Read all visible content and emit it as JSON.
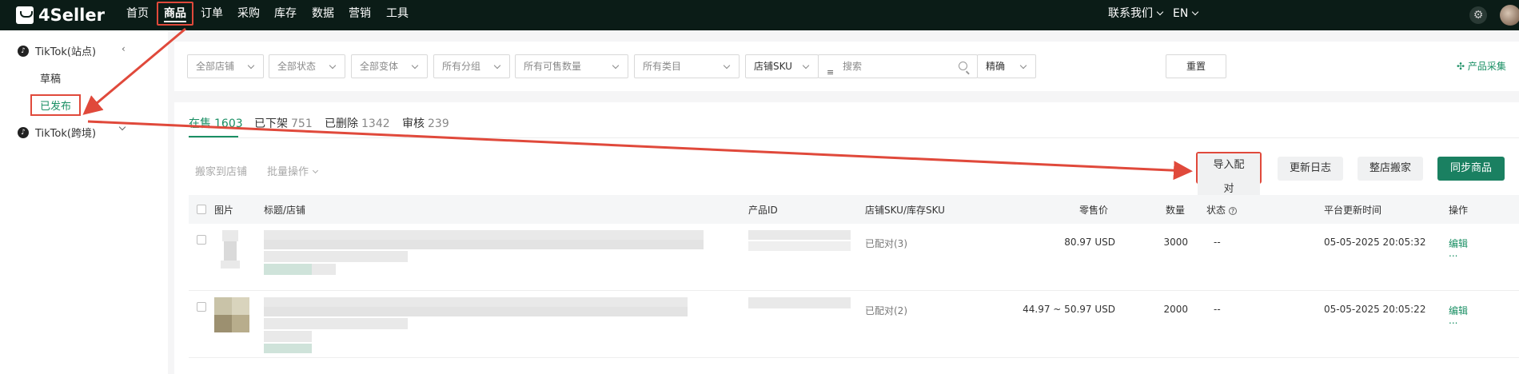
{
  "brand": "4Seller",
  "nav": [
    "首页",
    "商品",
    "订单",
    "采购",
    "库存",
    "数据",
    "营销",
    "工具"
  ],
  "top_right": {
    "contact": "联系我们",
    "lang": "EN"
  },
  "sidebar": {
    "group1": "TikTok(站点)",
    "sub1": "草稿",
    "sub2": "已发布",
    "group2": "TikTok(跨境)"
  },
  "filters": {
    "store": "全部店铺",
    "status": "全部状态",
    "variant": "全部变体",
    "group": "所有分组",
    "sellable": "所有可售数量",
    "category": "所有类目",
    "sku_type": "店铺SKU",
    "search_placeholder": "搜索",
    "match": "精确",
    "reset": "重置",
    "collect": "产品采集"
  },
  "tabs": [
    {
      "label": "在售",
      "count": "1603"
    },
    {
      "label": "已下架",
      "count": "751"
    },
    {
      "label": "已删除",
      "count": "1342"
    },
    {
      "label": "审核",
      "count": "239"
    }
  ],
  "toolbar": {
    "move": "搬家到店铺",
    "batch": "批量操作",
    "import": "导入配对",
    "log": "更新日志",
    "whole_move": "整店搬家",
    "sync": "同步商品"
  },
  "columns": {
    "image": "图片",
    "title": "标题/店铺",
    "pid": "产品ID",
    "sku": "店铺SKU/库存SKU",
    "price": "零售价",
    "qty": "数量",
    "status": "状态",
    "updated": "平台更新时间",
    "action": "操作"
  },
  "rows": [
    {
      "sku": "已配对(3)",
      "price": "80.97 USD",
      "qty": "3000",
      "status": "--",
      "updated": "05-05-2025 20:05:32",
      "edit": "编辑",
      "more": "..."
    },
    {
      "sku": "已配对(2)",
      "price": "44.97 ~ 50.97 USD",
      "qty": "2000",
      "status": "--",
      "updated": "05-05-2025 20:05:22",
      "edit": "编辑",
      "more": "..."
    }
  ],
  "colors": {
    "accent": "#1a8f64",
    "primary_btn": "#1a8061",
    "annotation": "#e0493b",
    "topbar": "#0b1c17"
  }
}
